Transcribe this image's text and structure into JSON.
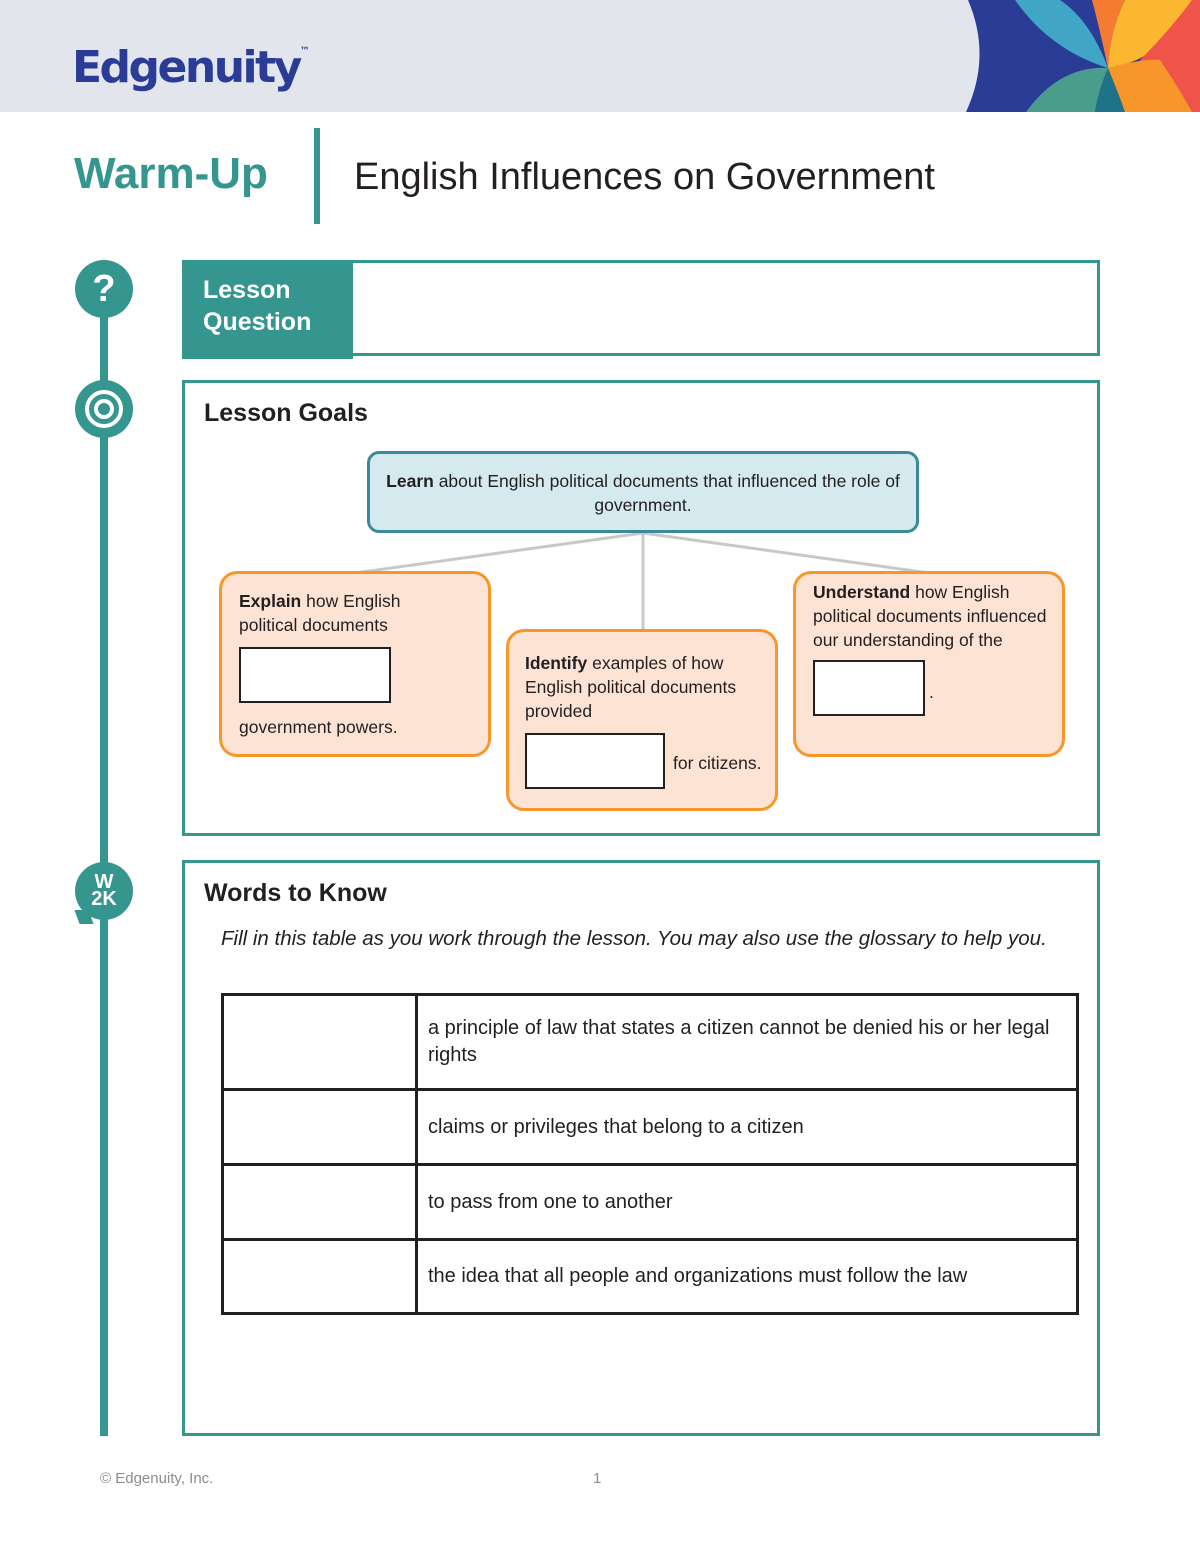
{
  "header": {
    "brand": "Edgenuity",
    "brand_mark": "™",
    "colors": {
      "band": "#e2e5ec",
      "brand_blue": "#2a3c95",
      "accent_teal": "#35958f",
      "deco_light_blue": "#41a6c6",
      "deco_green": "#4a9d8c",
      "deco_dark_teal": "#1e7386",
      "deco_orange": "#f47b32",
      "deco_yellow": "#fbb731",
      "deco_light_orange": "#f7962b",
      "deco_red": "#ef5349"
    }
  },
  "title": {
    "label": "Warm-Up",
    "subtitle": "English Influences on Government"
  },
  "icons": {
    "question": "?",
    "w2k_top": "W",
    "w2k_bottom": "2K"
  },
  "lesson_question": {
    "label_line1": "Lesson",
    "label_line2": "Question",
    "value": ""
  },
  "lesson_goals": {
    "heading": "Lesson Goals",
    "main": {
      "verb": "Learn",
      "text": " about English political documents that influenced the role of government."
    },
    "explain": {
      "verb": "Explain",
      "text_before": " how English political documents",
      "blank_value": "",
      "text_after": "government powers."
    },
    "identify": {
      "verb": "Identify",
      "text_before": " examples of how English political documents provided",
      "blank_value": "",
      "text_after": "for citizens."
    },
    "understand": {
      "verb": "Understand",
      "text_before": " how English political documents influenced our understanding of the",
      "blank_value": "",
      "text_after": "."
    },
    "colors": {
      "main_fill": "#d4eaef",
      "main_border": "#3a8a9a",
      "sub_fill": "#fde3d3",
      "sub_border": "#f7962b"
    }
  },
  "words_to_know": {
    "heading": "Words to Know",
    "instructions": "Fill in this table as you work through the lesson. You may also use the glossary to help you.",
    "rows": [
      {
        "term": "",
        "definition": "a principle of law that states a citizen cannot be denied his or her legal rights"
      },
      {
        "term": "",
        "definition": "claims or privileges that belong to a citizen"
      },
      {
        "term": "",
        "definition": "to pass from one to another"
      },
      {
        "term": "",
        "definition": "the idea that all people and organizations must follow the law"
      }
    ]
  },
  "footer": {
    "copyright": "© Edgenuity, Inc.",
    "page_number": "1"
  }
}
